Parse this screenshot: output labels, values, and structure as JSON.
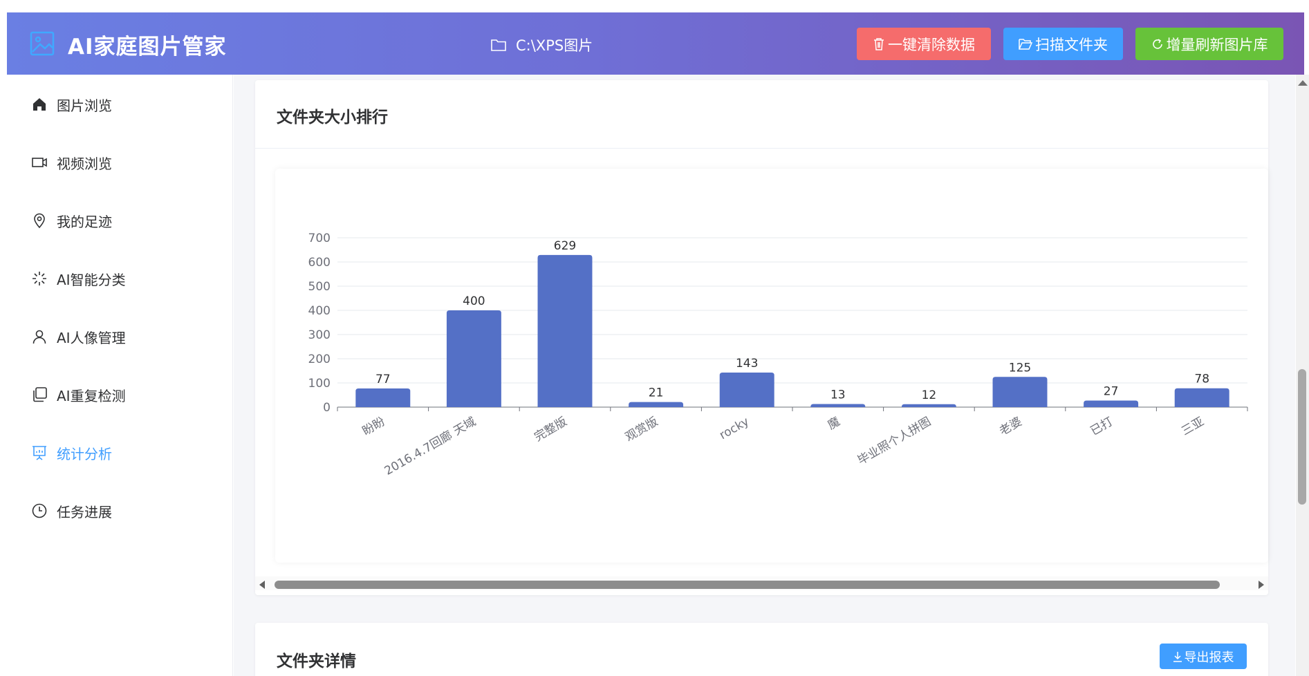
{
  "header": {
    "app_title": "AI家庭图片管家",
    "path": "C:\\XPS图片",
    "clear_button": "一键清除数据",
    "scan_button": "扫描文件夹",
    "refresh_button": "增量刷新图片库"
  },
  "sidebar": {
    "items": [
      {
        "label": "图片浏览",
        "icon": "home-icon",
        "active": false
      },
      {
        "label": "视频浏览",
        "icon": "video-camera-icon",
        "active": false
      },
      {
        "label": "我的足迹",
        "icon": "location-pin-icon",
        "active": false
      },
      {
        "label": "AI智能分类",
        "icon": "loading-sparkle-icon",
        "active": false
      },
      {
        "label": "AI人像管理",
        "icon": "user-icon",
        "active": false
      },
      {
        "label": "AI重复检测",
        "icon": "copy-documents-icon",
        "active": false
      },
      {
        "label": "统计分析",
        "icon": "presentation-chart-icon",
        "active": true
      },
      {
        "label": "任务进展",
        "icon": "clock-icon",
        "active": false
      }
    ]
  },
  "folder_ranking": {
    "title": "文件夹大小排行"
  },
  "folder_details": {
    "title": "文件夹详情",
    "export_button": "导出报表"
  },
  "colors": {
    "accent": "#409eff",
    "danger": "#f56c6c",
    "success": "#67c23a",
    "bar": "#5470c6"
  },
  "chart_data": {
    "type": "bar",
    "categories": [
      "盼盼",
      "2016.4.7回廊 天域",
      "完整版",
      "观赏版",
      "rocky",
      "魔",
      "毕业照个人拼图",
      "老婆",
      "已打",
      "三亚"
    ],
    "values": [
      77,
      400,
      629,
      21,
      143,
      13,
      12,
      125,
      27,
      78
    ],
    "ylim": [
      0,
      700
    ],
    "yticks": [
      0,
      100,
      200,
      300,
      400,
      500,
      600,
      700
    ],
    "grid": true,
    "data_labels": true
  }
}
